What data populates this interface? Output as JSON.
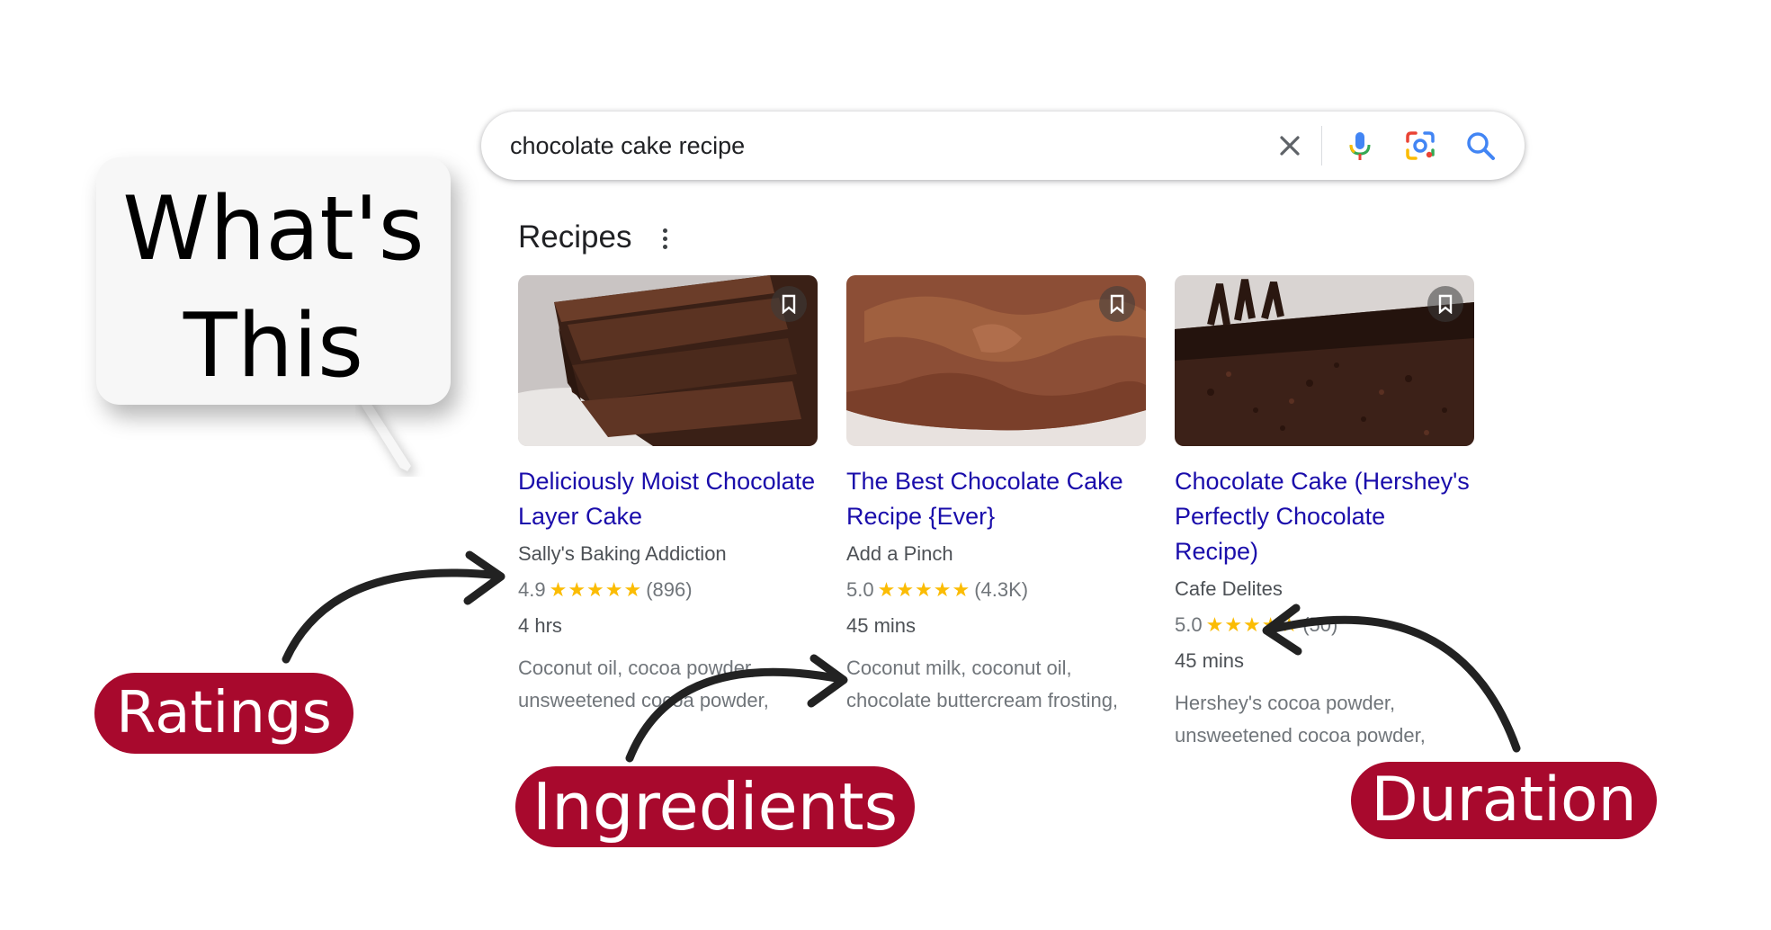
{
  "search": {
    "query": "chocolate cake recipe"
  },
  "icons": {
    "clear": "close-icon",
    "voice": "microphone-icon",
    "lens": "camera-lens-icon",
    "search": "search-icon",
    "more": "more-vert-icon",
    "bookmark": "bookmark-icon",
    "star": "star-icon"
  },
  "recipes": {
    "heading": "Recipes",
    "cards": [
      {
        "title_line1": "Deliciously Moist Chocolate",
        "title_line2": "Layer Cake",
        "source": "Sally's Baking Addiction",
        "rating": "4.9",
        "stars": "★★★★★",
        "reviews": "(896)",
        "time": "4 hrs",
        "ingredients_line1": "Coconut oil, cocoa powder,",
        "ingredients_line2": "unsweetened cocoa powder,"
      },
      {
        "title_line1": "The Best Chocolate Cake",
        "title_line2": "Recipe {Ever}",
        "source": "Add a Pinch",
        "rating": "5.0",
        "stars": "★★★★★",
        "reviews": "(4.3K)",
        "time": "45 mins",
        "ingredients_line1": "Coconut milk, coconut oil,",
        "ingredients_line2": "chocolate buttercream frosting,"
      },
      {
        "title_line1": "Chocolate Cake (Hershey's",
        "title_line2": "Perfectly Chocolate Recipe)",
        "source": "Cafe Delites",
        "rating": "5.0",
        "stars": "★★★★★",
        "reviews": "(50)",
        "time": "45 mins",
        "ingredients_line1": "Hershey's cocoa powder,",
        "ingredients_line2": "unsweetened cocoa powder,"
      }
    ]
  },
  "annotations": {
    "bubble_line1": "What's",
    "bubble_line2": "This",
    "ratings": "Ratings",
    "ingredients": "Ingredients",
    "duration": "Duration"
  },
  "colors": {
    "link": "#1a0dab",
    "star": "#fbbc04",
    "pill": "#a8092d",
    "arrow": "#222222"
  }
}
